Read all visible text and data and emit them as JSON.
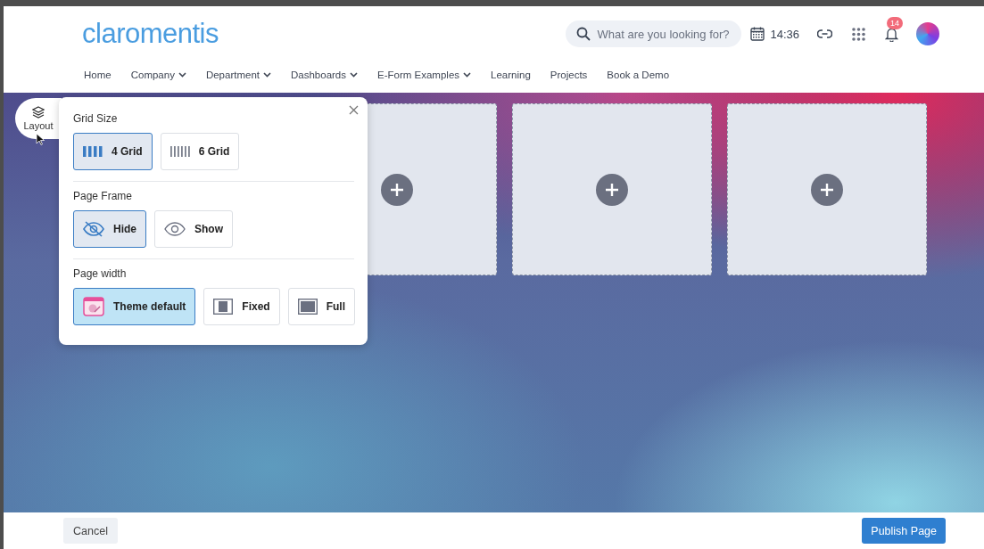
{
  "header": {
    "logo": "claromentis",
    "search": {
      "placeholder": "What are you looking for?"
    },
    "time": "14:36",
    "notifications": "14"
  },
  "nav": [
    {
      "label": "Home",
      "dropdown": false
    },
    {
      "label": "Company",
      "dropdown": true
    },
    {
      "label": "Department",
      "dropdown": true
    },
    {
      "label": "Dashboards",
      "dropdown": true
    },
    {
      "label": "E-Form Examples",
      "dropdown": true
    },
    {
      "label": "Learning",
      "dropdown": false
    },
    {
      "label": "Projects",
      "dropdown": false
    },
    {
      "label": "Book a Demo",
      "dropdown": false
    }
  ],
  "layout_tab": {
    "label": "Layout"
  },
  "layout_panel": {
    "sections": [
      {
        "title": "Grid Size",
        "options": [
          {
            "label": "4 Grid",
            "kind": "grid4",
            "selected": true
          },
          {
            "label": "6 Grid",
            "kind": "grid6",
            "selected": false
          }
        ]
      },
      {
        "title": "Page Frame",
        "options": [
          {
            "label": "Hide",
            "kind": "hide",
            "selected": true
          },
          {
            "label": "Show",
            "kind": "show",
            "selected": false
          }
        ]
      },
      {
        "title": "Page width",
        "options": [
          {
            "label": "Theme default",
            "kind": "theme",
            "selected": true
          },
          {
            "label": "Fixed",
            "kind": "fixed",
            "selected": false
          },
          {
            "label": "Full",
            "kind": "full",
            "selected": false
          }
        ]
      }
    ]
  },
  "footer": {
    "cancel": "Cancel",
    "publish": "Publish Page"
  }
}
